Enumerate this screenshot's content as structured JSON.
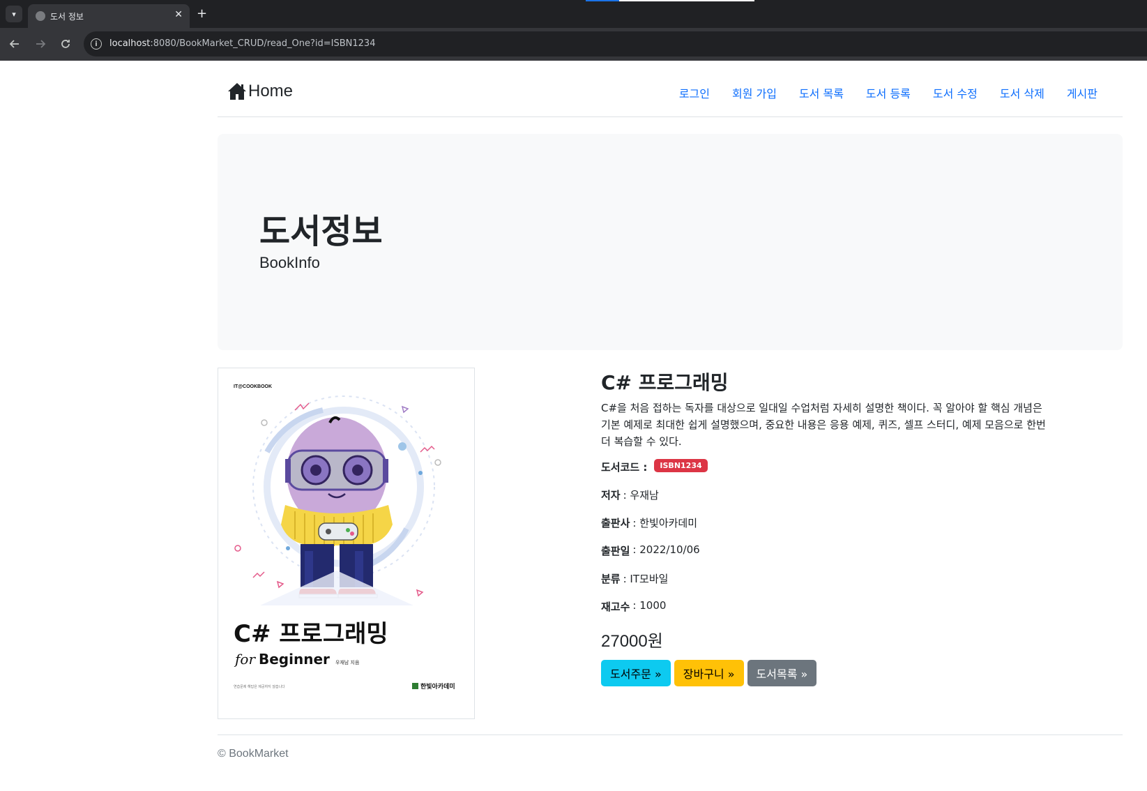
{
  "browser": {
    "tab_title": "도서 정보",
    "new_tab_label": "+",
    "close_label": "✕",
    "url_host": "localhost",
    "url_path": ":8080/BookMarket_CRUD/read_One?id=ISBN1234"
  },
  "header": {
    "brand_label": "Home",
    "nav": [
      "로그인",
      "회원 가입",
      "도서 목록",
      "도서 등록",
      "도서 수정",
      "도서 삭제",
      "게시판"
    ]
  },
  "jumbotron": {
    "title": "도서정보",
    "subtitle": "BookInfo"
  },
  "cover": {
    "series": "IT@COOKBOOK",
    "title": "C# 프로그래밍",
    "subtitle_for": "for",
    "subtitle_main": "Beginner",
    "author_note": "우재남 지음",
    "tagline": "연습문제 해답은 제공하지 않습니다",
    "publisher": "한빛아카데미",
    "colors": {
      "body": "#c9a9d9",
      "sweater": "#f5d547",
      "pants": "#232a6e",
      "shoes": "#e8473c"
    }
  },
  "book": {
    "name": "C# 프로그래밍",
    "description": "C#을 처음 접하는 독자를 대상으로 일대일 수업처럼 자세히 설명한 책이다. 꼭 알아야 할 핵심 개념은 기본 예제로 최대한 쉽게 설명했으며, 중요한 내용은 응용 예제, 퀴즈, 셀프 스터디, 예제 모음으로 한번 더 복습할 수 있다.",
    "code_label": "도서코드 :",
    "code_value": "ISBN1234",
    "author_label": "저자",
    "author_value": ": 우재남",
    "publisher_label": "출판사",
    "publisher_value": ": 한빛아카데미",
    "date_label": "출판일",
    "date_value": ": 2022/10/06",
    "category_label": "분류",
    "category_value": ": IT모바일",
    "stock_label": "재고수",
    "stock_value": ": 1000",
    "price": "27000원"
  },
  "buttons": {
    "order": "도서주문 »",
    "cart": "장바구니 »",
    "list": "도서목록 »"
  },
  "footer": {
    "text": "© BookMarket"
  }
}
